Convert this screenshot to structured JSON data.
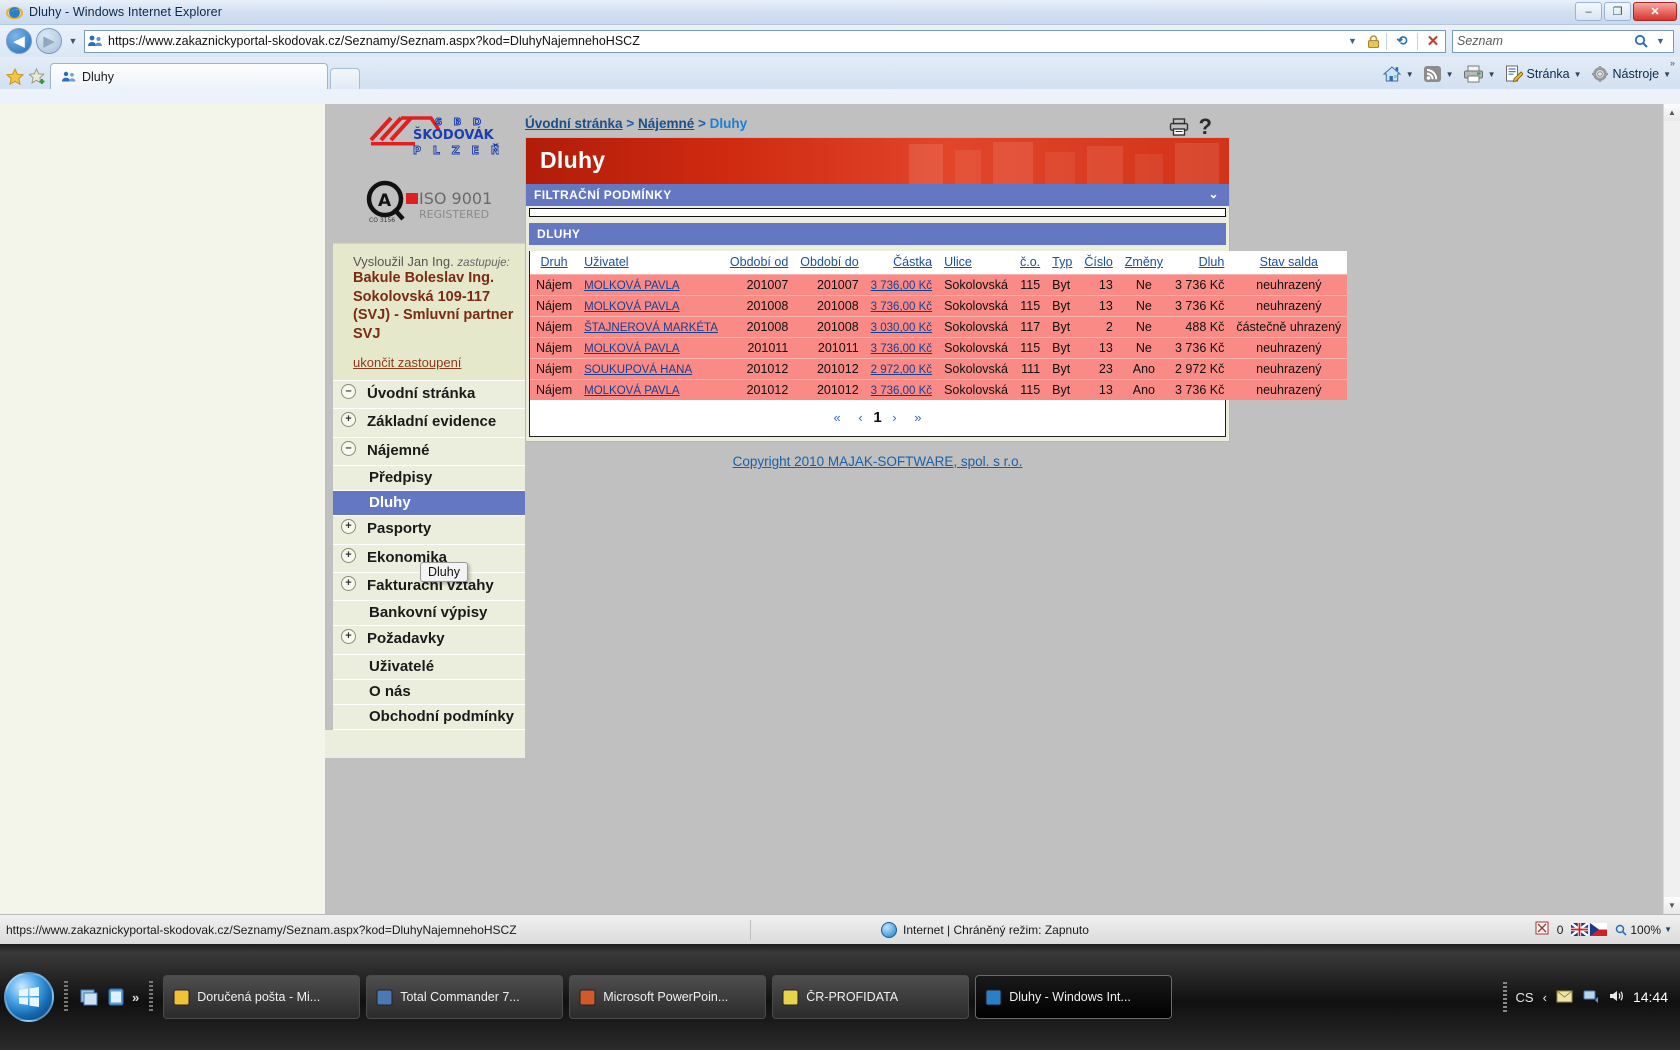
{
  "window": {
    "title": "Dluhy - Windows Internet Explorer",
    "minimize": "–",
    "maximize": "❐",
    "close": "✕"
  },
  "browser": {
    "url": "https://www.zakaznickyportal-skodovak.cz/Seznamy/Seznam.aspx?kod=DluhyNajemnehoHSCZ",
    "search_placeholder": "Seznam",
    "tab_label": "Dluhy",
    "commands": [
      {
        "name": "page-menu",
        "label": "Stránka"
      },
      {
        "name": "tools-menu",
        "label": "Nástroje"
      }
    ]
  },
  "sidebar": {
    "logo_primary_lines": [
      "S B D",
      "ŠKODOVÁK",
      "P L Z E Ň"
    ],
    "logo_iso": {
      "title": "ISO 9001",
      "sub": "REGISTERED",
      "code": "CO 3156"
    },
    "user": {
      "line1_name": "Vysloužil Jan Ing.",
      "line1_note": "zastupuje:",
      "represented": "Bakule Boleslav Ing.",
      "address": "Sokolovská 109-117",
      "org": "(SVJ) - Smluvní partner",
      "org2": "SVJ",
      "end_link": "ukončit zastoupení"
    },
    "items": [
      {
        "label": "Úvodní stránka",
        "toggle": "–",
        "level": 1,
        "active": false
      },
      {
        "label": "Základní evidence",
        "toggle": "+",
        "level": 1,
        "active": false
      },
      {
        "label": "Nájemné",
        "toggle": "–",
        "level": 1,
        "active": false
      },
      {
        "label": "Předpisy",
        "toggle": "",
        "level": 2,
        "active": false
      },
      {
        "label": "Dluhy",
        "toggle": "",
        "level": 2,
        "active": true
      },
      {
        "label": "Pasporty",
        "toggle": "+",
        "level": 1,
        "active": false
      },
      {
        "label": "Ekonomika",
        "toggle": "+",
        "level": 1,
        "active": false
      },
      {
        "label": "Fakturační vztahy",
        "toggle": "+",
        "level": 1,
        "active": false
      },
      {
        "label": "Bankovní výpisy",
        "toggle": "",
        "level": 2,
        "active": false
      },
      {
        "label": "Požadavky",
        "toggle": "+",
        "level": 1,
        "active": false
      },
      {
        "label": "Uživatelé",
        "toggle": "",
        "level": 2,
        "active": false
      },
      {
        "label": "O nás",
        "toggle": "",
        "level": 2,
        "active": false
      },
      {
        "label": "Obchodní podmínky",
        "toggle": "",
        "level": 2,
        "active": false
      }
    ],
    "tooltip": "Dluhy"
  },
  "main": {
    "breadcrumb": {
      "item1": "Úvodní stránka",
      "sep1": ">",
      "item2": "Nájemné",
      "sep2": ">",
      "current": "Dluhy"
    },
    "page_title": "Dluhy",
    "filter_panel_title": "FILTRAČNÍ PODMÍNKY",
    "grid_panel_title": "DLUHY",
    "columns": [
      "Druh",
      "Uživatel",
      "Období od",
      "Období do",
      "Částka",
      "Ulice",
      "č.o.",
      "Typ",
      "Číslo",
      "Změny",
      "Dluh",
      "Stav salda"
    ],
    "rows": [
      {
        "druh": "Nájem",
        "uzivatel": "MOLKOVÁ PAVLA",
        "od": "201007",
        "do": "201007",
        "castka": "3 736,00 Kč",
        "ulice": "Sokolovská",
        "co": "115",
        "typ": "Byt",
        "cislo": "13",
        "zmeny": "Ne",
        "dluh": "3 736 Kč",
        "stav": "neuhrazený"
      },
      {
        "druh": "Nájem",
        "uzivatel": "MOLKOVÁ PAVLA",
        "od": "201008",
        "do": "201008",
        "castka": "3 736,00 Kč",
        "ulice": "Sokolovská",
        "co": "115",
        "typ": "Byt",
        "cislo": "13",
        "zmeny": "Ne",
        "dluh": "3 736 Kč",
        "stav": "neuhrazený"
      },
      {
        "druh": "Nájem",
        "uzivatel": "ŠTAJNEROVÁ MARKÉTA",
        "od": "201008",
        "do": "201008",
        "castka": "3 030,00 Kč",
        "ulice": "Sokolovská",
        "co": "117",
        "typ": "Byt",
        "cislo": "2",
        "zmeny": "Ne",
        "dluh": "488 Kč",
        "stav": "částečně uhrazený"
      },
      {
        "druh": "Nájem",
        "uzivatel": "MOLKOVÁ PAVLA",
        "od": "201011",
        "do": "201011",
        "castka": "3 736,00 Kč",
        "ulice": "Sokolovská",
        "co": "115",
        "typ": "Byt",
        "cislo": "13",
        "zmeny": "Ne",
        "dluh": "3 736 Kč",
        "stav": "neuhrazený"
      },
      {
        "druh": "Nájem",
        "uzivatel": "SOUKUPOVÁ HANA",
        "od": "201012",
        "do": "201012",
        "castka": "2 972,00 Kč",
        "ulice": "Sokolovská",
        "co": "111",
        "typ": "Byt",
        "cislo": "23",
        "zmeny": "Ano",
        "dluh": "2 972 Kč",
        "stav": "neuhrazený"
      },
      {
        "druh": "Nájem",
        "uzivatel": "MOLKOVÁ PAVLA",
        "od": "201012",
        "do": "201012",
        "castka": "3 736,00 Kč",
        "ulice": "Sokolovská",
        "co": "115",
        "typ": "Byt",
        "cislo": "13",
        "zmeny": "Ano",
        "dluh": "3 736 Kč",
        "stav": "neuhrazený"
      }
    ],
    "pager": {
      "first": "«",
      "prev": "‹",
      "current": "1",
      "next": "›",
      "last": "»"
    },
    "copyright": "Copyright 2010 MAJAK-SOFTWARE, spol. s r.o."
  },
  "statusbar": {
    "url": "https://www.zakaznickyportal-skodovak.cz/Seznamy/Seznam.aspx?kod=DluhyNajemnehoHSCZ",
    "zone": "Internet | Chráněný režim: Zapnuto",
    "error_count": "0",
    "zoom": "100%"
  },
  "taskbar": {
    "buttons": [
      {
        "label": "Doručená pošta - Mi...",
        "active": false
      },
      {
        "label": "Total Commander 7...",
        "active": false
      },
      {
        "label": "Microsoft PowerPoin...",
        "active": false
      },
      {
        "label": "ČR-PROFIDATA",
        "active": false
      },
      {
        "label": "Dluhy - Windows Int...",
        "active": true
      }
    ],
    "language": "CS",
    "clock": "14:44"
  },
  "colors": {
    "accent_blue": "#6477c2",
    "banner_red": "#cf2a10",
    "row_red": "#f98a85",
    "sidebar_cream": "#eceedd"
  }
}
